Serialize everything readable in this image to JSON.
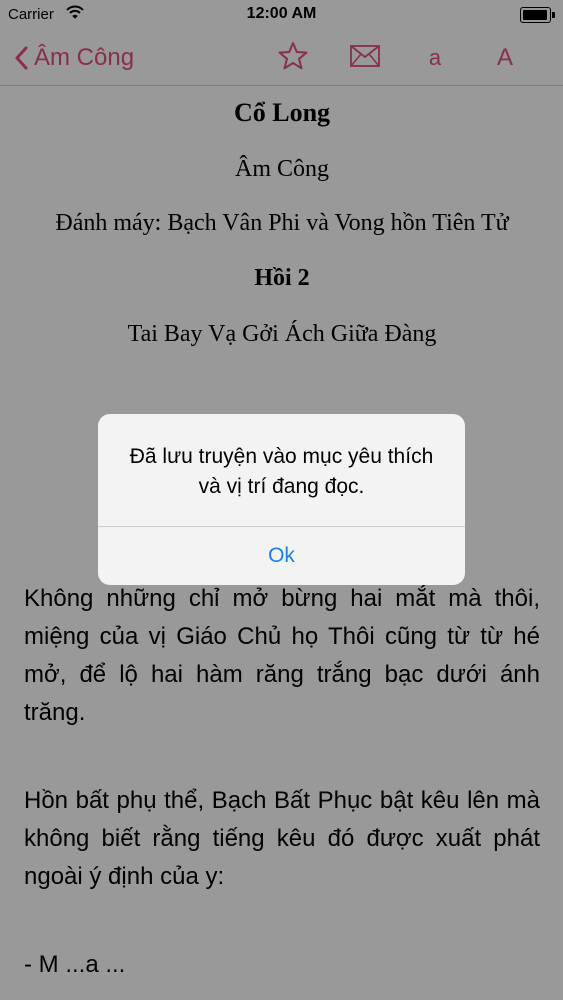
{
  "status_bar": {
    "carrier": "Carrier",
    "time": "12:00 AM",
    "battery_level": 1.0
  },
  "nav": {
    "back_label": "Âm Công",
    "font_small_label": "a",
    "font_large_label": "A",
    "accent_color": "#e2507a",
    "icons": [
      "chevron-left-icon",
      "star-icon",
      "mail-icon"
    ]
  },
  "content": {
    "book_title": "Cổ Long",
    "author": "Âm Công",
    "typist": "Đánh máy: Bạch Vân Phi và Vong hồn Tiên Tử",
    "chapter": "Hồi 2",
    "chapter_title": "Tai Bay Vạ Gởi Ách Giữa Đàng",
    "paragraphs": [
      "Không những chỉ mở bừng hai mắt mà thôi, miệng của vị Giáo Chủ họ Thôi cũng từ từ hé mở, để lộ hai hàm răng trắng bạc dưới ánh trăng.",
      "Hồn bất phụ thể, Bạch Bất Phục bật kêu lên mà không biết rằng tiếng kêu đó được xuất phát ngoài ý định của y:",
      "- M ...a ..."
    ]
  },
  "alert": {
    "message": "Đã lưu truyện vào mục yêu thích và vị trí đang đọc.",
    "ok_label": "Ok",
    "button_color": "#1a7ee8"
  }
}
